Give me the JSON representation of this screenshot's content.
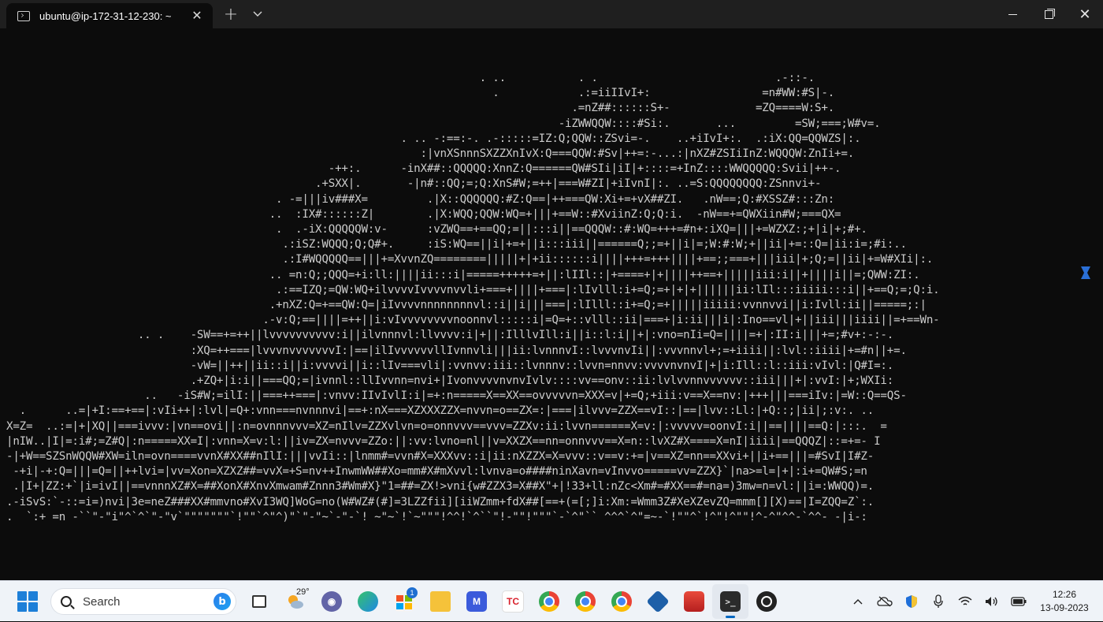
{
  "window": {
    "tab_title": "ubuntu@ip-172-31-12-230: ~"
  },
  "terminal": {
    "ascii_art": "                                                                        . ..           . .                           .-::-.\n                                                                          .            .:=iiIIvI+:                 =n#WW:#S|-.\n                                                                                      .=nZ##::::::S+-             =ZQ====W:S+.\n                                                                                    -iZWWQQW::::#Si:.       ...         =SW;===;W#v=.\n                                                            . .. -:==:-. .-:::::=IZ:Q;QQW::ZSvi=-.    ..+iIvI+:.  .:iX:QQ=QQWZS|:.\n                                                               :|vnXSnnnSXZZXnIvX:Q===QQW:#Sv|++=:-...:|nXZ#ZSIiInZ:WQQQW:ZnIi+=.\n                                                 -++:.      -inX##::QQQQQ:XnnZ:Q======QW#SIi|iI|+::::=+InZ::::WWQQQQQ:Svii|++-.\n                                               .+SXX|.       -|n#::QQ;=;Q:XnS#W;=++|===W#ZI|+iIvnI|:. ..=S:QQQQQQQQ:ZSnnvi+-\n                                         . -=|||iv###X=         .|X::QQQQQQ:#Z:Q==|++===QW:Xi+=+vX##ZI.   .nW==;Q:#XSSZ#:::Zn:\n                                        ..  :IX#::::::Z|        .|X:WQQ;QQW:WQ=+|||+==W::#XviinZ:Q;Q:i.  -nW==+=QWXiin#W;===QX=\n                                         .  .-iX:QQQQQW:v-      :vZWQ==+==QQ;=||:::i||==QQQW::#:WQ=+++=#n+:iXQ=|||+=WZXZ:;+|i|+;#+.\n                                          .:iSZ:WQQQ;Q;Q#+.     :iS:WQ==||i|+=+||i:::iii||======Q;;=+||i|=;W:#:W;+||ii|+=::Q=|ii:i=;#i:..\n                                          .:I#WQQQQQ==|||+=XvvnZQ========|||||+|+ii::::::i||||+++=+++||||+==;;===+|||iii|+;Q;=||ii|+=W#XIi|:.\n                                        .. =n:Q;;QQQ=+i:ll:||||ii:::i|=====+++++=+||:lIIl::|+====+|+||||++==+|||||iii:i||+||||i||=;QWW:ZI:.\n                                         .:==IZQ;=QW:WQ+ilvvvvIvvvvnvvli+===+||||+===|:lIvlll:i+=Q;=+|+|+||||||ii:lIl:::iiiii:::i||+==Q;=;Q:i.\n                                        .+nXZ:Q=+==QW:Q=|iIvvvvnnnnnnnnvl::i||i|||===|:lIlll::i+=Q;=+|||||iiiii:vvnnvvi||i:Ivll:ii||=====;:|\n                                       .-v:Q;==||||=++||i:vIvvvvvvvvnoonnvl:::::i|=Q=+::vlll::ii|===+|i:ii|||i|:Ino==vl|+||iii|||iiii||=+==Wn-\n                    .. .    -SW==+=++||lvvvvvvvvvv:i||ilvnnnvl:llvvvv:i|+||:IlllvIll:i||i::l:i||+|:vno=nIi=Q=||||=+|:II:i|||+=;#v+:-:-.\n                            :XQ=++===|lvvvnvvvvvvvI:|==|ilIvvvvvvllIvnnvli|||ii:lvnnnvI::lvvvnvIi||:vvvnnvl+;=+iiii||:lvl::iiii|+=#n||+=.\n                            -vW=||++||ii::i||i:vvvvi||i::lIv===vli|:vvnvv:iii::lvnnnv::lvvn=nnvv:vvvvnvnvI|+|i:Ill::l::iii:vIvl:|Q#I=:.\n                            .+ZQ+|i:i||===QQ;=|ivnnl::llIvvnn=nvi+|IvonvvvvnvnvIvlv::::vv==onv::ii:lvlvvnnvvvvvv::iii|||+|:vvI:|+;WXIi:\n                     ..   -iS#W;=ilI:||===++===|:vnvv:IIvIvlI:i|=+:n=====X==XX==ovvvvvn=XXX=v|+=Q;+iii:v==X==nv:|+++|||===iIv:|=W::Q==QS-\n  .      ..=|+I:==+==|:vIi++|:lvl|=Q+:vnn===nvnnnvi|==+:nX===XZXXXZZX=nvvn=o==ZX=:|===|ilvvv=ZZX==vI::|==|lvv::Ll:|+Q::;|ii|;:v:. ..\nX=Z=  ..:=|+|XQ||===ivvv:|vn==ovi||:n=ovnnnvvv=XZ=nIlv=ZZXvlvn=o=onnvvv==vvv=ZZXv:ii:lvvn======X=v:|:vvvvv=oonvI:i||==||||==Q:|:::.  =\n|nIW..|I|=:i#;=Z#Q|:n=====XX=I|:vnn=X=v:l:||iv=ZX=nvvv=ZZo:||:vv:lvno=nl||v=XXZX==nn=onnvvv==X=n::lvXZ#X====X=nI|iiii|==QQQZ|::=+=- I\n-|+W==SZSnWQQW#XW=iln=ovn====vvnX#XX##nIlI:|||vvIi::|lnmm#=vvn#X=XXXvv::i|ii:nXZZX=X=vvv::v==v:+=|v==XZ=nn==XXvi+||i+==|||=#SvI|I#Z-\n -+i|-+:Q=|||=Q=||++lvi=|vv=Xon=XZXZ##=vvX=+S=nv++InwmWW##Xo=mm#X#mXvvl:lvnva=o####ninXavn=vInvvo=====vv=ZZX}`|na>=l=|+|:i+=QW#S;=n\n .|I+|ZZ:+`|i=ivI||==vnnnXZ#X=##XonX#XnvXmwam#Znnn3#Wm#X}\"1=##=ZX!>vni{w#ZZX3=X##X\"+|!33+ll:nZc<Xm#=#XX==#=na=)3mw=n=vl:||i=:WWQQ)=.\n.-iSvS:`-::=i=)nvi|3e=neZ###XX#mmvno#XvI3WQ]WoG=no(W#WZ#(#]=3LZZfii][iiWZmm+fdX##[==+(=[;]i:Xm:=Wmm3Z#XeXZevZQ=mmm[][X)==|I=ZQQ=Z`:.\n.  `:+ =n -``\"-\"i\"^`^`\"-\"v`\"\"\"\"\"\"\"`!\"\"`^\"^)\"`\"-\"~`-\"-`! ~\"~`!`~\"\"\"!^^!`^``\"!-\"\"!\"\"\"`-`^\"`` ^^^`^\"=~-`!\"\"^`!^\"!^\"\"!^-^\"^^-`^^- -|i-:"
  },
  "taskbar": {
    "search_placeholder": "Search",
    "weather_temp": "29°",
    "store_badge": "1",
    "tc_label": "TC",
    "time": "12:26",
    "date": "13-09-2023"
  },
  "colors": {
    "terminal_bg": "#0c0c0c",
    "titlebar_bg": "#1f1f1f",
    "terminal_fg": "#cccccc",
    "taskbar_bg": "#eff3f8",
    "accent": "#0067c0"
  }
}
